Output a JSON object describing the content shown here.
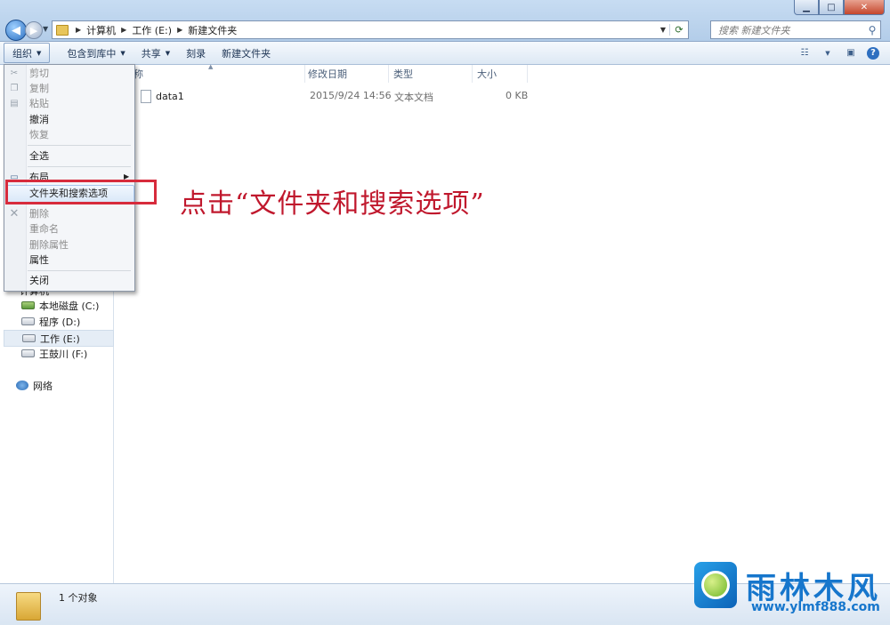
{
  "window": {
    "caption_min": "▁",
    "caption_max": "□",
    "caption_close": "✕"
  },
  "address_bar": {
    "crumbs": [
      "计算机",
      "工作 (E:)",
      "新建文件夹"
    ],
    "search_placeholder": "搜索 新建文件夹"
  },
  "toolbar": {
    "organize": "组织",
    "include_in_library": "包含到库中",
    "share": "共享",
    "burn": "刻录",
    "new_folder": "新建文件夹"
  },
  "columns": {
    "name": "称",
    "date_modified": "修改日期",
    "type": "类型",
    "size": "大小"
  },
  "files": [
    {
      "name": "data1",
      "date": "2015/9/24 14:56",
      "type": "文本文档",
      "size": "0 KB"
    }
  ],
  "organize_menu": {
    "items": [
      {
        "label": "剪切",
        "disabled": true
      },
      {
        "label": "复制",
        "disabled": true
      },
      {
        "label": "粘贴",
        "disabled": true
      },
      {
        "label": "撤消",
        "disabled": false
      },
      {
        "label": "恢复",
        "disabled": true
      },
      {
        "label": "全选",
        "disabled": false
      },
      {
        "label": "布局",
        "disabled": false
      },
      {
        "label": "文件夹和搜索选项",
        "disabled": false
      },
      {
        "label": "删除",
        "disabled": true
      },
      {
        "label": "重命名",
        "disabled": true
      },
      {
        "label": "删除属性",
        "disabled": true
      },
      {
        "label": "属性",
        "disabled": false
      },
      {
        "label": "关闭",
        "disabled": false
      }
    ],
    "highlighted": "文件夹和搜索选项"
  },
  "nav_pane": {
    "computer_partial": "计算机",
    "drives": [
      {
        "label": "本地磁盘 (C:)",
        "icon": "system-drive-icon"
      },
      {
        "label": "程序 (D:)",
        "icon": "drive-icon"
      },
      {
        "label": "工作 (E:)",
        "icon": "drive-icon",
        "selected": true
      },
      {
        "label": "王鼓川 (F:)",
        "icon": "drive-icon"
      }
    ],
    "network": "网络"
  },
  "status_bar": {
    "count": "1 个对象"
  },
  "annotation": {
    "text": "点击“文件夹和搜索选项”",
    "color": "#c0182d"
  },
  "watermark": {
    "title": "雨林木风",
    "url": "www.ylmf888.com"
  }
}
